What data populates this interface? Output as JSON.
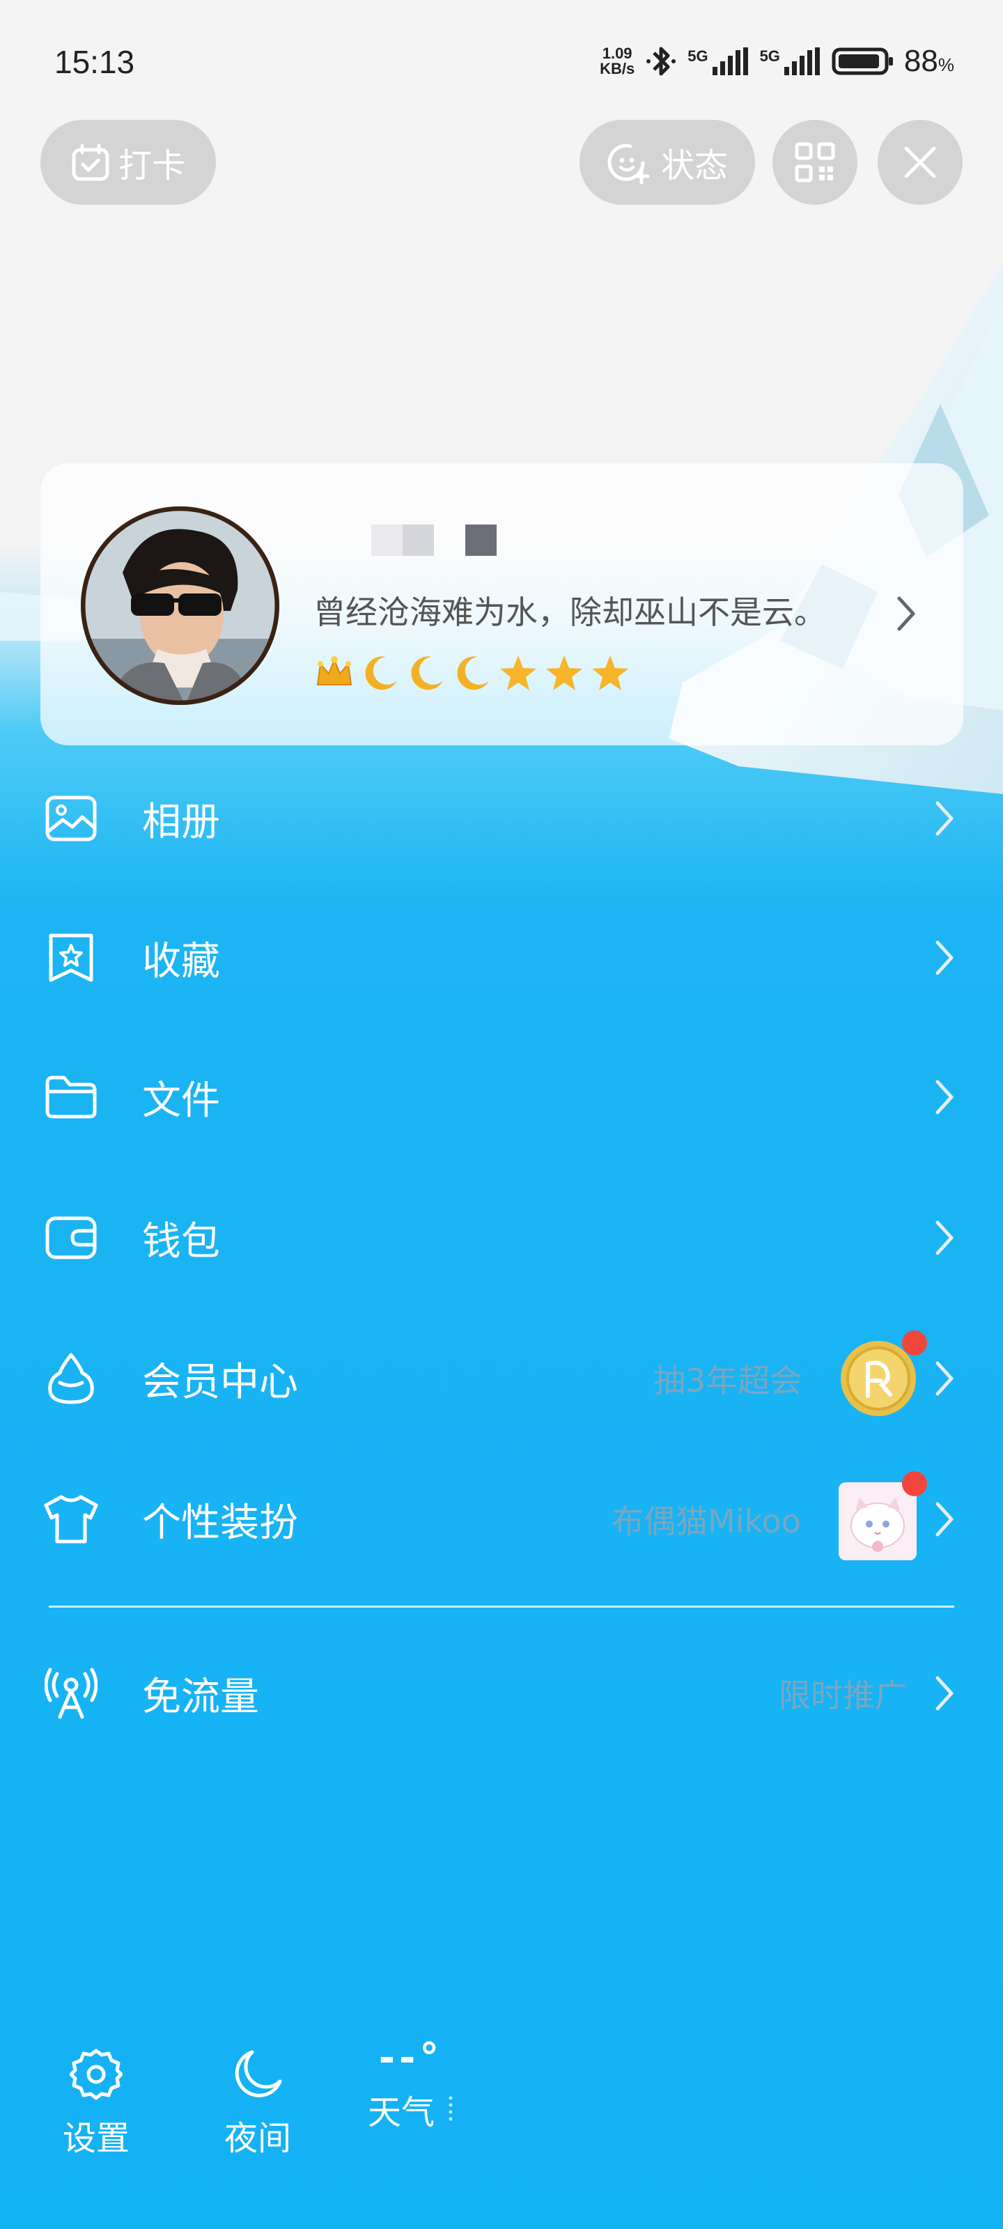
{
  "status_bar": {
    "time": "15:13",
    "net_speed_value": "1.09",
    "net_speed_unit": "KB/s",
    "sim1": "5G",
    "sim2": "5G",
    "battery": "88",
    "battery_unit": "%"
  },
  "top": {
    "checkin_label": "打卡",
    "status_label": "状态"
  },
  "profile": {
    "signature": "曾经沧海难为水，除却巫山不是云。",
    "level_icons": [
      "crown",
      "moon",
      "moon",
      "moon",
      "star",
      "star",
      "star"
    ]
  },
  "menu": [
    {
      "label": "相册",
      "icon": "album-icon"
    },
    {
      "label": "收藏",
      "icon": "favorites-icon"
    },
    {
      "label": "文件",
      "icon": "folder-icon"
    },
    {
      "label": "钱包",
      "icon": "wallet-icon"
    },
    {
      "label": "会员中心",
      "icon": "vip-icon",
      "sub": "抽3年超会"
    },
    {
      "label": "个性装扮",
      "icon": "shirt-icon",
      "sub": "布偶猫Mikoo"
    },
    {
      "label": "免流量",
      "icon": "free-data-icon",
      "sub": "限时推广"
    }
  ],
  "bottom": {
    "settings_label": "设置",
    "night_label": "夜间",
    "weather_temp": "--°",
    "weather_label": "天气"
  },
  "colors": {
    "accent": "#13b2f4",
    "badge": "#f1463c"
  }
}
